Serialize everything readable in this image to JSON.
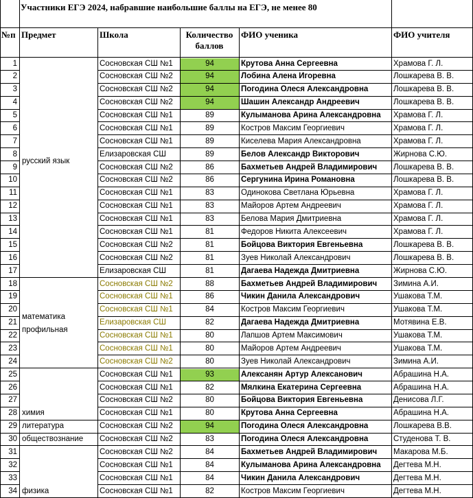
{
  "title": "Участники ЕГЭ 2024, набравшие  наибольшие баллы на ЕГЭ, не менее  80",
  "headers": {
    "num": "№п",
    "subject": "Предмет",
    "school": "Школа",
    "score": "Количество баллов",
    "student": "ФИО ученика",
    "teacher": "ФИО учителя"
  },
  "colors": {
    "highlight": "#92d050",
    "grid": "#000000",
    "olive_text": "#8a7a00"
  },
  "subjects": [
    {
      "label": "русский язык",
      "first_row": 1,
      "last_row": 17,
      "label_row": 9
    },
    {
      "label": "математика профильная",
      "first_row": 18,
      "last_row": 24,
      "label_row": 21
    },
    {
      "label": "химия",
      "first_row": 25,
      "last_row": 28,
      "label_row": 28
    },
    {
      "label": "литература",
      "first_row": 29,
      "last_row": 29,
      "label_row": 29
    },
    {
      "label": "обществознание",
      "first_row": 30,
      "last_row": 30,
      "label_row": 30
    },
    {
      "label": "физика",
      "first_row": 31,
      "last_row": 34,
      "label_row": 34
    }
  ],
  "rows": [
    {
      "n": "1",
      "school": "Сосновская СШ №1",
      "score": "94",
      "student": "Крутова Анна Сергеевна",
      "teacher": "Храмова Г. Л.",
      "hl": true,
      "bold": true
    },
    {
      "n": "2",
      "school": "Сосновская СШ №2",
      "score": "94",
      "student": "Лобина Алена Игоревна",
      "teacher": "Лошкарева В. В.",
      "hl": true,
      "bold": true
    },
    {
      "n": "3",
      "school": "Сосновская СШ №2",
      "score": "94",
      "student": "Погодина Олеся Александровна",
      "teacher": "Лошкарева В. В.",
      "hl": true,
      "bold": true
    },
    {
      "n": "4",
      "school": "Сосновская СШ №2",
      "score": "94",
      "student": "Шашин Александр Андреевич",
      "teacher": "Лошкарева В. В.",
      "hl": true,
      "bold": true
    },
    {
      "n": "5",
      "school": "Сосновская СШ №1",
      "score": "89",
      "student": "Кулыманова Арина Александровна",
      "teacher": "Храмова Г. Л.",
      "hl": false,
      "bold": true
    },
    {
      "n": "6",
      "school": "Сосновская СШ №1",
      "score": "89",
      "student": "Костров Максим Георгиевич",
      "teacher": "Храмова Г. Л.",
      "hl": false,
      "bold": false
    },
    {
      "n": "7",
      "school": "Сосновская СШ №1",
      "score": "89",
      "student": "Киселева Мария Александровна",
      "teacher": "Храмова Г. Л.",
      "hl": false,
      "bold": false
    },
    {
      "n": "8",
      "school": "Елизаровская СШ",
      "score": "89",
      "student": "Белов Александр Викторович",
      "teacher": "Жирнова С.Ю.",
      "hl": false,
      "bold": true
    },
    {
      "n": "9",
      "school": "Сосновская СШ №2",
      "score": "86",
      "student": "Бахметьев Андрей Владимирович",
      "teacher": "Лошкарева В. В.",
      "hl": false,
      "bold": true
    },
    {
      "n": "10",
      "school": "Сосновская СШ №2",
      "score": "86",
      "student": "Сергунина Ирина Романовна",
      "teacher": "Лошкарева В. В.",
      "hl": false,
      "bold": true
    },
    {
      "n": "11",
      "school": "Сосновская СШ №1",
      "score": "83",
      "student": "Одинокова Светлана Юрьевна",
      "teacher": "Храмова Г. Л.",
      "hl": false,
      "bold": false
    },
    {
      "n": "12",
      "school": "Сосновская СШ №1",
      "score": "83",
      "student": "Майоров Артем Андреевич",
      "teacher": "Храмова Г. Л.",
      "hl": false,
      "bold": false
    },
    {
      "n": "13",
      "school": "Сосновская СШ №1",
      "score": "83",
      "student": "Белова Мария Дмитриевна",
      "teacher": "Храмова Г. Л.",
      "hl": false,
      "bold": false
    },
    {
      "n": "14",
      "school": "Сосновская СШ №1",
      "score": "81",
      "student": "Федоров Никита Алексеевич",
      "teacher": "Храмова Г. Л.",
      "hl": false,
      "bold": false
    },
    {
      "n": "15",
      "school": "Сосновская СШ №2",
      "score": "81",
      "student": "Бойцова Виктория Евгеньевна",
      "teacher": "Лошкарева В. В.",
      "hl": false,
      "bold": true
    },
    {
      "n": "16",
      "school": "Сосновская СШ №2",
      "score": "81",
      "student": "Зуев Николай Александрович",
      "teacher": "Лошкарева В. В.",
      "hl": false,
      "bold": false
    },
    {
      "n": "17",
      "school": "Елизаровская СШ",
      "score": "81",
      "student": "Дагаева Надежда Дмитриевна",
      "teacher": "Жирнова С.Ю.",
      "hl": false,
      "bold": true
    },
    {
      "n": "18",
      "school": "Сосновская СШ №2",
      "score": "88",
      "student": "Бахметьев Андрей Владимирович",
      "teacher": "Зимина А.И.",
      "hl": false,
      "bold": true,
      "olive": true
    },
    {
      "n": "19",
      "school": "Сосновская СШ №1",
      "score": "86",
      "student": "Чикин Данила Александрович",
      "teacher": "Ушакова Т.М.",
      "hl": false,
      "bold": true,
      "olive": true
    },
    {
      "n": "20",
      "school": "Сосновская СШ №1",
      "score": "84",
      "student": "Костров Максим Георгиевич",
      "teacher": "Ушакова Т.М.",
      "hl": false,
      "bold": false,
      "olive": true
    },
    {
      "n": "21",
      "school": "Елизаровская СШ",
      "score": "82",
      "student": "Дагаева Надежда Дмитриевна",
      "teacher": "Мотявина Е.В.",
      "hl": false,
      "bold": true,
      "olive": true
    },
    {
      "n": "22",
      "school": "Сосновская СШ №1",
      "score": "80",
      "student": "Лапшов Артем Максимович",
      "teacher": "Ушакова Т.М.",
      "hl": false,
      "bold": false,
      "olive": true
    },
    {
      "n": "23",
      "school": "Сосновская СШ №1",
      "score": "80",
      "student": "Майоров Артем Андреевич",
      "teacher": "Ушакова Т.М.",
      "hl": false,
      "bold": false,
      "olive": true
    },
    {
      "n": "24",
      "school": "Сосновская СШ №2",
      "score": "80",
      "student": "Зуев Николай Александрович",
      "teacher": "Зимина А.И.",
      "hl": false,
      "bold": false,
      "olive": true
    },
    {
      "n": "25",
      "school": "Сосновская СШ №1",
      "score": "93",
      "student": "Алексанян Артур Алексанович",
      "teacher": "Абрашина Н.А.",
      "hl": true,
      "bold": true
    },
    {
      "n": "26",
      "school": "Сосновская СШ №1",
      "score": "82",
      "student": "Мялкина Екатерина Сергеевна",
      "teacher": "Абрашина Н.А.",
      "hl": false,
      "bold": true
    },
    {
      "n": "27",
      "school": "Сосновская СШ №2",
      "score": "80",
      "student": "Бойцова Виктория Евгеньевна",
      "teacher": "Денисова Л.Г.",
      "hl": false,
      "bold": true
    },
    {
      "n": "28",
      "school": "Сосновская СШ №1",
      "score": "80",
      "student": "Крутова Анна Сергеевна",
      "teacher": "Абрашина Н.А.",
      "hl": false,
      "bold": true
    },
    {
      "n": "29",
      "school": "Сосновская СШ №2",
      "score": "94",
      "student": "Погодина Олеся Александровна",
      "teacher": "Лошкарева В.В.",
      "hl": true,
      "bold": true
    },
    {
      "n": "30",
      "school": "Сосновская СШ №2",
      "score": "83",
      "student": "Погодина Олеся Александровна",
      "teacher": "Студенова Т. В.",
      "hl": false,
      "bold": true
    },
    {
      "n": "31",
      "school": "Сосновская СШ №2",
      "score": "84",
      "student": "Бахметьев Андрей Владимирович",
      "teacher": "Макарова М.Б.",
      "hl": false,
      "bold": true
    },
    {
      "n": "32",
      "school": "Сосновская СШ №1",
      "score": "84",
      "student": "Кулыманова Арина Александровна",
      "teacher": "Дегтева М.Н.",
      "hl": false,
      "bold": true
    },
    {
      "n": "33",
      "school": "Сосновская СШ №1",
      "score": "84",
      "student": "Чикин Данила Александрович",
      "teacher": "Дегтева М.Н.",
      "hl": false,
      "bold": true
    },
    {
      "n": "34",
      "school": "Сосновская СШ №1",
      "score": "82",
      "student": "Костров Максим Георгиевич",
      "teacher": "Дегтева М.Н.",
      "hl": false,
      "bold": false
    }
  ]
}
